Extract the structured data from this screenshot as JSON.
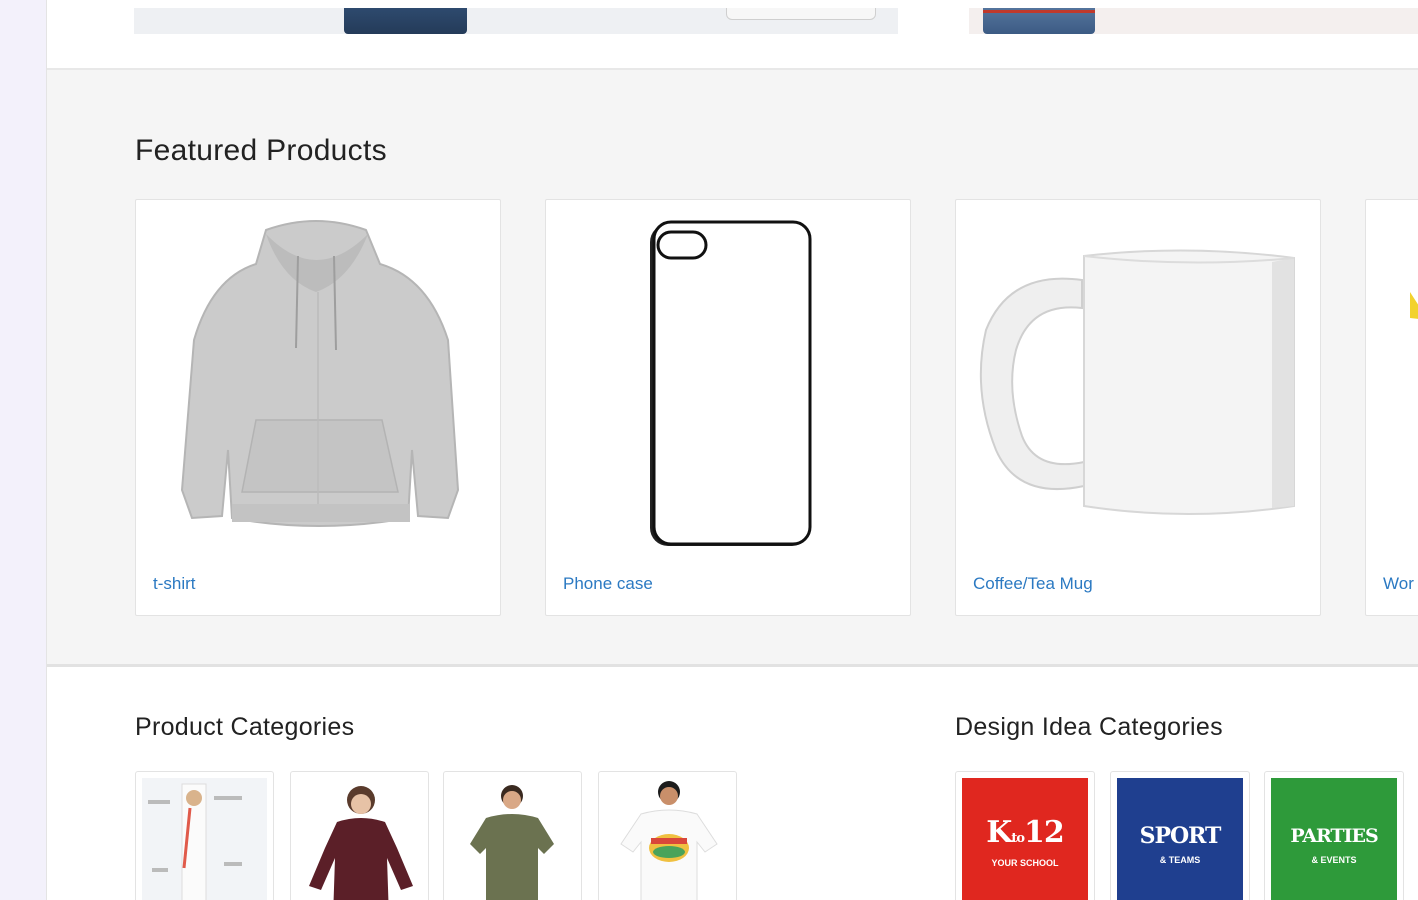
{
  "featured": {
    "title": "Featured Products",
    "products": [
      {
        "label": "t-shirt",
        "icon": "hoodie-icon"
      },
      {
        "label": "Phone case",
        "icon": "phone-case-icon"
      },
      {
        "label": "Coffee/Tea Mug",
        "icon": "mug-icon"
      },
      {
        "label": "Wor",
        "icon": "product-icon"
      }
    ]
  },
  "categories": {
    "product_title": "Product Categories",
    "design_title": "Design Idea Categories",
    "design_ideas": [
      {
        "big": "K",
        "mid": "to",
        "big2": "12",
        "small": "YOUR SCHOOL",
        "color": "#e0271f"
      },
      {
        "big": "SPORT",
        "small": "& TEAMS",
        "color": "#1f3f8f"
      },
      {
        "big": "PARTIES",
        "small": "& EVENTS",
        "color": "#2e9a3a"
      }
    ]
  },
  "colors": {
    "link": "#2b79c2",
    "background": "#f5f5f5"
  }
}
